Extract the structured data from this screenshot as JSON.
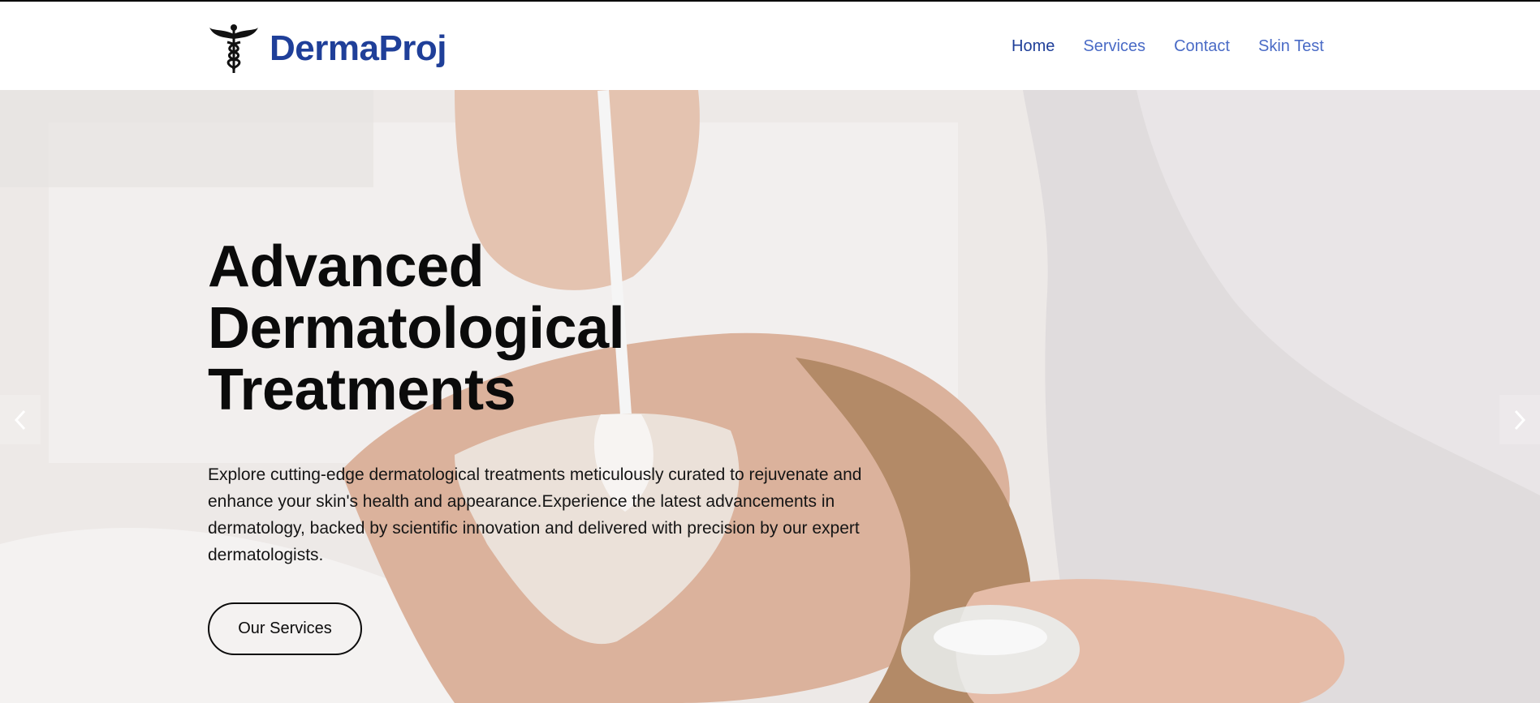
{
  "brand": {
    "name": "DermaProj",
    "logo_icon": "caduceus-icon"
  },
  "nav": {
    "items": [
      {
        "label": "Home",
        "active": true
      },
      {
        "label": "Services",
        "active": false
      },
      {
        "label": "Contact",
        "active": false
      },
      {
        "label": "Skin Test",
        "active": false
      }
    ]
  },
  "hero": {
    "title_lines": [
      "Advanced",
      "Dermatological",
      "Treatments"
    ],
    "subtitle": "Explore cutting-edge dermatological treatments meticulously curated to rejuvenate and enhance your skin's health and appearance.Experience the latest advancements in dermatology, backed by scientific innovation and delivered with precision by our expert dermatologists.",
    "cta_label": "Our Services",
    "prev_icon": "chevron-left-icon",
    "next_icon": "chevron-right-icon"
  },
  "colors": {
    "brand": "#1f3f99",
    "nav_link": "#4a6bc6",
    "text": "#0b0b0b"
  }
}
